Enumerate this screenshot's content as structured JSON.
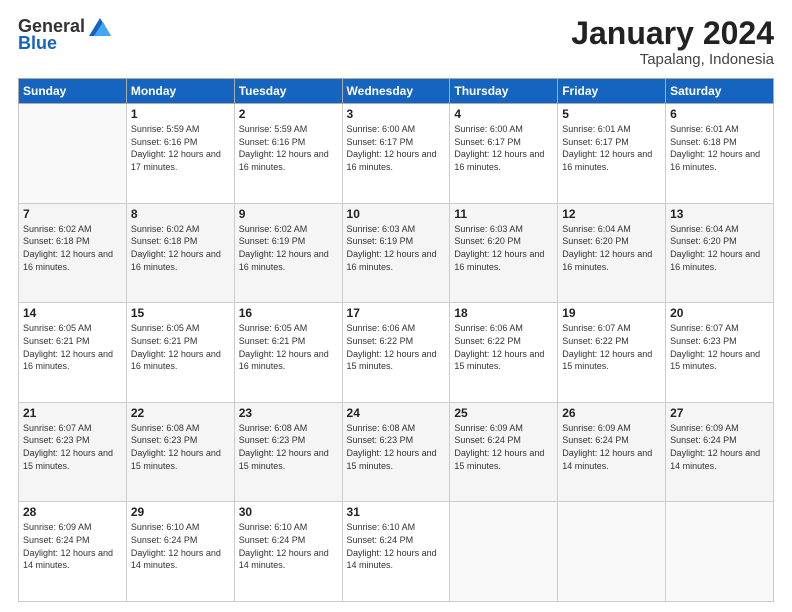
{
  "logo": {
    "general": "General",
    "blue": "Blue"
  },
  "header": {
    "month": "January 2024",
    "location": "Tapalang, Indonesia"
  },
  "days_of_week": [
    "Sunday",
    "Monday",
    "Tuesday",
    "Wednesday",
    "Thursday",
    "Friday",
    "Saturday"
  ],
  "weeks": [
    [
      {
        "day": "",
        "sunrise": "",
        "sunset": "",
        "daylight": ""
      },
      {
        "day": "1",
        "sunrise": "5:59 AM",
        "sunset": "6:16 PM",
        "daylight": "12 hours and 17 minutes."
      },
      {
        "day": "2",
        "sunrise": "5:59 AM",
        "sunset": "6:16 PM",
        "daylight": "12 hours and 16 minutes."
      },
      {
        "day": "3",
        "sunrise": "6:00 AM",
        "sunset": "6:17 PM",
        "daylight": "12 hours and 16 minutes."
      },
      {
        "day": "4",
        "sunrise": "6:00 AM",
        "sunset": "6:17 PM",
        "daylight": "12 hours and 16 minutes."
      },
      {
        "day": "5",
        "sunrise": "6:01 AM",
        "sunset": "6:17 PM",
        "daylight": "12 hours and 16 minutes."
      },
      {
        "day": "6",
        "sunrise": "6:01 AM",
        "sunset": "6:18 PM",
        "daylight": "12 hours and 16 minutes."
      }
    ],
    [
      {
        "day": "7",
        "sunrise": "6:02 AM",
        "sunset": "6:18 PM",
        "daylight": "12 hours and 16 minutes."
      },
      {
        "day": "8",
        "sunrise": "6:02 AM",
        "sunset": "6:18 PM",
        "daylight": "12 hours and 16 minutes."
      },
      {
        "day": "9",
        "sunrise": "6:02 AM",
        "sunset": "6:19 PM",
        "daylight": "12 hours and 16 minutes."
      },
      {
        "day": "10",
        "sunrise": "6:03 AM",
        "sunset": "6:19 PM",
        "daylight": "12 hours and 16 minutes."
      },
      {
        "day": "11",
        "sunrise": "6:03 AM",
        "sunset": "6:20 PM",
        "daylight": "12 hours and 16 minutes."
      },
      {
        "day": "12",
        "sunrise": "6:04 AM",
        "sunset": "6:20 PM",
        "daylight": "12 hours and 16 minutes."
      },
      {
        "day": "13",
        "sunrise": "6:04 AM",
        "sunset": "6:20 PM",
        "daylight": "12 hours and 16 minutes."
      }
    ],
    [
      {
        "day": "14",
        "sunrise": "6:05 AM",
        "sunset": "6:21 PM",
        "daylight": "12 hours and 16 minutes."
      },
      {
        "day": "15",
        "sunrise": "6:05 AM",
        "sunset": "6:21 PM",
        "daylight": "12 hours and 16 minutes."
      },
      {
        "day": "16",
        "sunrise": "6:05 AM",
        "sunset": "6:21 PM",
        "daylight": "12 hours and 16 minutes."
      },
      {
        "day": "17",
        "sunrise": "6:06 AM",
        "sunset": "6:22 PM",
        "daylight": "12 hours and 15 minutes."
      },
      {
        "day": "18",
        "sunrise": "6:06 AM",
        "sunset": "6:22 PM",
        "daylight": "12 hours and 15 minutes."
      },
      {
        "day": "19",
        "sunrise": "6:07 AM",
        "sunset": "6:22 PM",
        "daylight": "12 hours and 15 minutes."
      },
      {
        "day": "20",
        "sunrise": "6:07 AM",
        "sunset": "6:23 PM",
        "daylight": "12 hours and 15 minutes."
      }
    ],
    [
      {
        "day": "21",
        "sunrise": "6:07 AM",
        "sunset": "6:23 PM",
        "daylight": "12 hours and 15 minutes."
      },
      {
        "day": "22",
        "sunrise": "6:08 AM",
        "sunset": "6:23 PM",
        "daylight": "12 hours and 15 minutes."
      },
      {
        "day": "23",
        "sunrise": "6:08 AM",
        "sunset": "6:23 PM",
        "daylight": "12 hours and 15 minutes."
      },
      {
        "day": "24",
        "sunrise": "6:08 AM",
        "sunset": "6:23 PM",
        "daylight": "12 hours and 15 minutes."
      },
      {
        "day": "25",
        "sunrise": "6:09 AM",
        "sunset": "6:24 PM",
        "daylight": "12 hours and 15 minutes."
      },
      {
        "day": "26",
        "sunrise": "6:09 AM",
        "sunset": "6:24 PM",
        "daylight": "12 hours and 14 minutes."
      },
      {
        "day": "27",
        "sunrise": "6:09 AM",
        "sunset": "6:24 PM",
        "daylight": "12 hours and 14 minutes."
      }
    ],
    [
      {
        "day": "28",
        "sunrise": "6:09 AM",
        "sunset": "6:24 PM",
        "daylight": "12 hours and 14 minutes."
      },
      {
        "day": "29",
        "sunrise": "6:10 AM",
        "sunset": "6:24 PM",
        "daylight": "12 hours and 14 minutes."
      },
      {
        "day": "30",
        "sunrise": "6:10 AM",
        "sunset": "6:24 PM",
        "daylight": "12 hours and 14 minutes."
      },
      {
        "day": "31",
        "sunrise": "6:10 AM",
        "sunset": "6:24 PM",
        "daylight": "12 hours and 14 minutes."
      },
      {
        "day": "",
        "sunrise": "",
        "sunset": "",
        "daylight": ""
      },
      {
        "day": "",
        "sunrise": "",
        "sunset": "",
        "daylight": ""
      },
      {
        "day": "",
        "sunrise": "",
        "sunset": "",
        "daylight": ""
      }
    ]
  ],
  "labels": {
    "sunrise_prefix": "Sunrise: ",
    "sunset_prefix": "Sunset: ",
    "daylight_prefix": "Daylight: "
  }
}
